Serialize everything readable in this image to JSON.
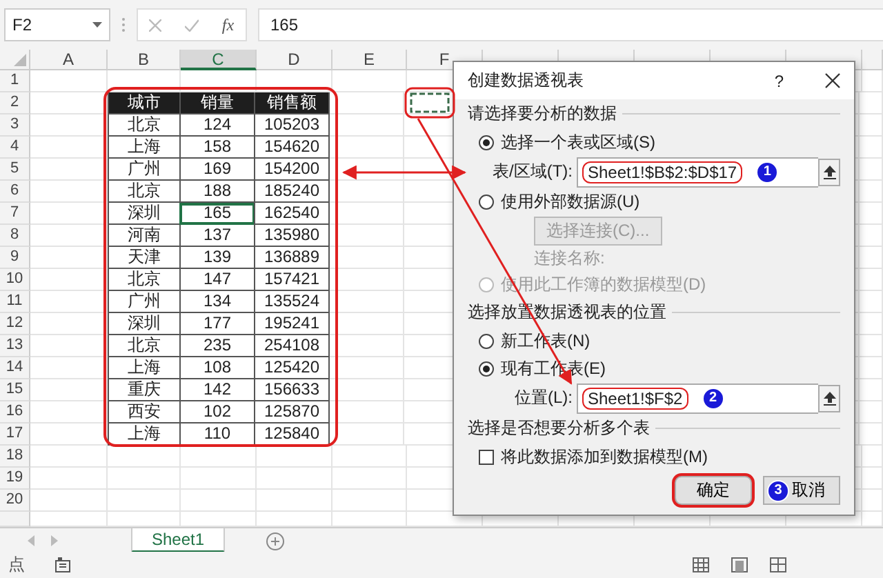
{
  "name_box": "F2",
  "formula_bar": {
    "fx": "fx",
    "value": "165"
  },
  "columns": [
    {
      "label": "A",
      "selected": false
    },
    {
      "label": "B",
      "selected": false
    },
    {
      "label": "C",
      "selected": true
    },
    {
      "label": "D",
      "selected": false
    },
    {
      "label": "E",
      "selected": false
    },
    {
      "label": "F",
      "selected": false
    }
  ],
  "rows": [
    "1",
    "2",
    "3",
    "4",
    "5",
    "6",
    "7",
    "8",
    "9",
    "10",
    "11",
    "12",
    "13",
    "14",
    "15",
    "16",
    "17",
    "18",
    "19",
    "20"
  ],
  "table": {
    "headers": [
      "城市",
      "销量",
      "销售额"
    ],
    "rows": [
      {
        "cells": [
          "北京",
          "124",
          "105203"
        ],
        "active": false
      },
      {
        "cells": [
          "上海",
          "158",
          "154620"
        ],
        "active": false
      },
      {
        "cells": [
          "广州",
          "169",
          "154200"
        ],
        "active": false
      },
      {
        "cells": [
          "北京",
          "188",
          "185240"
        ],
        "active": false
      },
      {
        "cells": [
          "深圳",
          "165",
          "162540"
        ],
        "active": true
      },
      {
        "cells": [
          "河南",
          "137",
          "135980"
        ],
        "active": false
      },
      {
        "cells": [
          "天津",
          "139",
          "136889"
        ],
        "active": false
      },
      {
        "cells": [
          "北京",
          "147",
          "157421"
        ],
        "active": false
      },
      {
        "cells": [
          "广州",
          "134",
          "135524"
        ],
        "active": false
      },
      {
        "cells": [
          "深圳",
          "177",
          "195241"
        ],
        "active": false
      },
      {
        "cells": [
          "北京",
          "235",
          "254108"
        ],
        "active": false
      },
      {
        "cells": [
          "上海",
          "108",
          "125420"
        ],
        "active": false
      },
      {
        "cells": [
          "重庆",
          "142",
          "156633"
        ],
        "active": false
      },
      {
        "cells": [
          "西安",
          "102",
          "125870"
        ],
        "active": false
      },
      {
        "cells": [
          "上海",
          "110",
          "125840"
        ],
        "active": false
      }
    ]
  },
  "dialog": {
    "title": "创建数据透视表",
    "help": "?",
    "sections": [
      {
        "heading": "请选择要分析的数据",
        "items": [
          {
            "kind": "radio",
            "label": "选择一个表或区域(S)",
            "selected": true,
            "disabled": false
          },
          {
            "kind": "field",
            "label": "表/区域(T):",
            "value": "Sheet1!$B$2:$D$17",
            "badge": "1"
          },
          {
            "kind": "radio",
            "label": "使用外部数据源(U)",
            "selected": false,
            "disabled": false
          },
          {
            "kind": "button",
            "label": "选择连接(C)...",
            "disabled": true
          },
          {
            "kind": "text",
            "label": "连接名称:",
            "disabled": true
          },
          {
            "kind": "radio",
            "label": "使用此工作簿的数据模型(D)",
            "selected": false,
            "disabled": true
          }
        ]
      },
      {
        "heading": "选择放置数据透视表的位置",
        "items": [
          {
            "kind": "radio",
            "label": "新工作表(N)",
            "selected": false,
            "disabled": false
          },
          {
            "kind": "radio",
            "label": "现有工作表(E)",
            "selected": true,
            "disabled": false
          },
          {
            "kind": "field",
            "label": "位置(L):",
            "value": "Sheet1!$F$2",
            "badge": "2"
          }
        ]
      },
      {
        "heading": "选择是否想要分析多个表",
        "items": [
          {
            "kind": "checkbox",
            "label": "将此数据添加到数据模型(M)",
            "checked": false
          }
        ]
      }
    ],
    "ok": "确定",
    "cancel": "取消",
    "cancel_badge": "3"
  },
  "sheet_tabs": [
    {
      "label": "Sheet1",
      "selected": true
    }
  ],
  "status_bar": {
    "text": "点"
  }
}
